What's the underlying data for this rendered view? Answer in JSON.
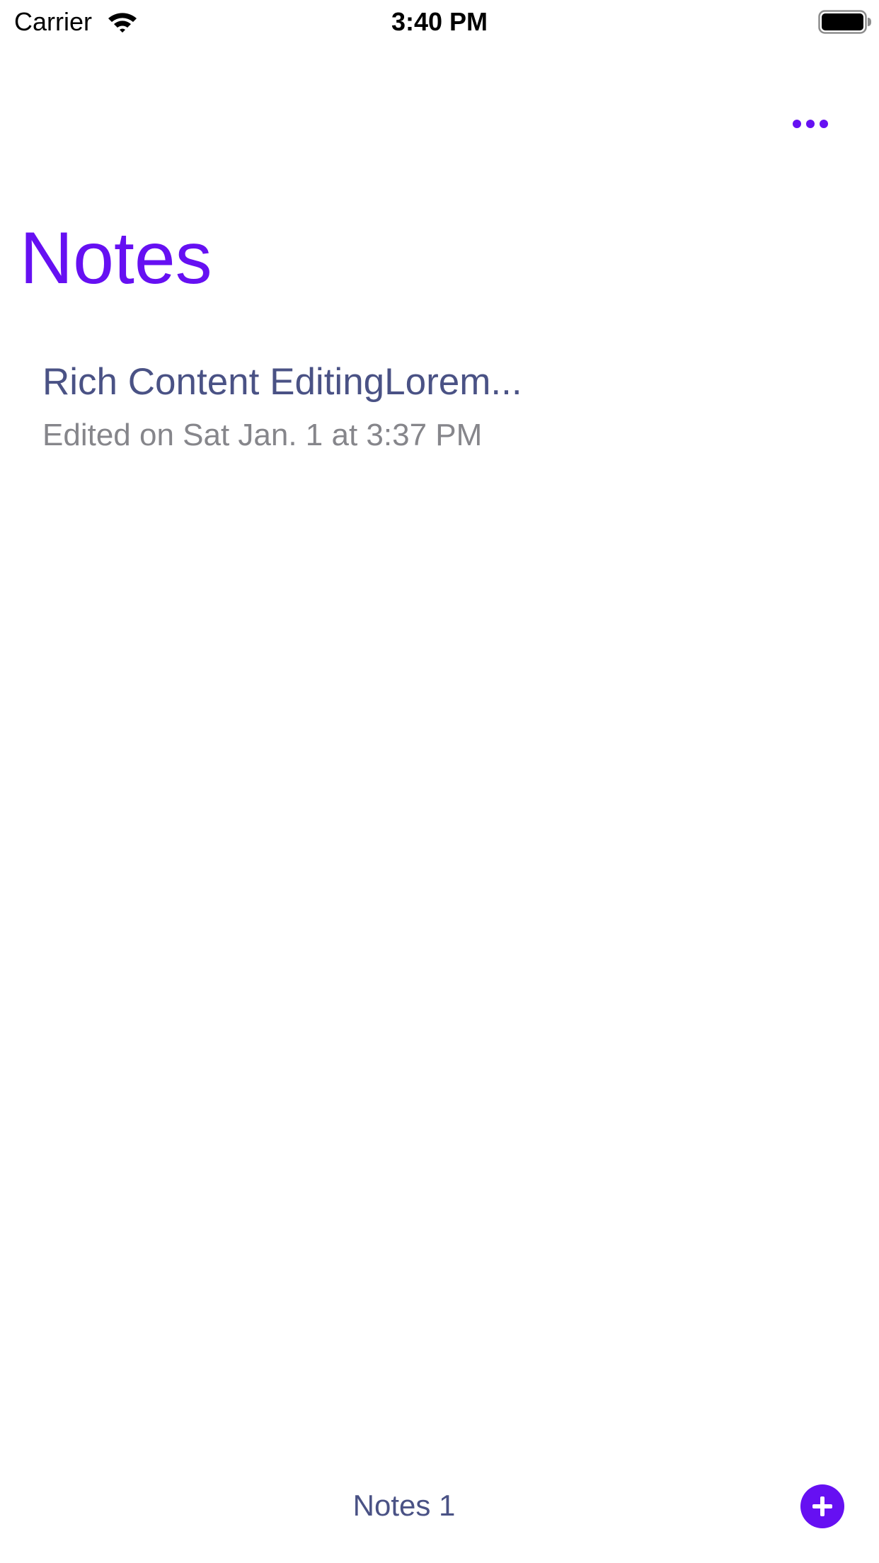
{
  "status_bar": {
    "carrier": "Carrier",
    "time": "3:40 PM",
    "wifi_icon": "wifi-icon",
    "battery_icon": "battery-full-icon"
  },
  "nav": {
    "more_icon": "ellipsis-icon",
    "title": "Notes"
  },
  "notes": [
    {
      "title": "Rich Content EditingLorem...",
      "subtitle": "Edited on Sat Jan. 1 at 3:37 PM"
    }
  ],
  "toolbar": {
    "count_label": "Notes 1",
    "add_icon": "plus-circle-icon"
  },
  "colors": {
    "accent": "#6610f2",
    "note_title": "#4a5285",
    "note_subtitle": "#86868b"
  }
}
